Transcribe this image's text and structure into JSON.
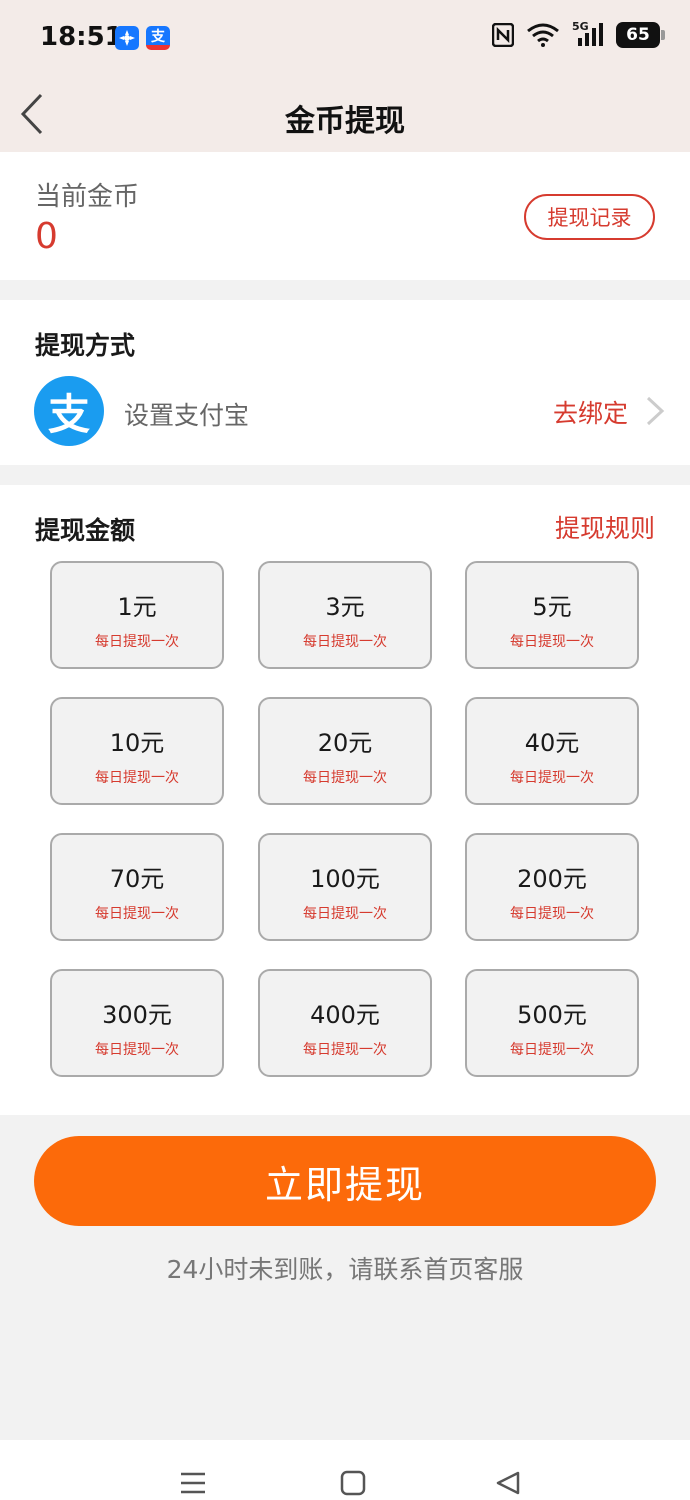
{
  "status_bar": {
    "time": "18:51",
    "app_icon_1": "pinwheel-app-icon",
    "app_icon_2_text": "支",
    "network": "5G",
    "battery": "65"
  },
  "nav": {
    "title": "金币提现",
    "back_icon": "chevron-left-icon"
  },
  "coins": {
    "label": "当前金币",
    "value": "0",
    "record_button": "提现记录"
  },
  "method": {
    "title": "提现方式",
    "icon_text": "支",
    "label": "设置支付宝",
    "bind_link": "去绑定"
  },
  "amount": {
    "title": "提现金额",
    "rules_link": "提现规则",
    "tiles": [
      {
        "value": "1元",
        "note": "每日提现一次"
      },
      {
        "value": "3元",
        "note": "每日提现一次"
      },
      {
        "value": "5元",
        "note": "每日提现一次"
      },
      {
        "value": "10元",
        "note": "每日提现一次"
      },
      {
        "value": "20元",
        "note": "每日提现一次"
      },
      {
        "value": "40元",
        "note": "每日提现一次"
      },
      {
        "value": "70元",
        "note": "每日提现一次"
      },
      {
        "value": "100元",
        "note": "每日提现一次"
      },
      {
        "value": "200元",
        "note": "每日提现一次"
      },
      {
        "value": "300元",
        "note": "每日提现一次"
      },
      {
        "value": "400元",
        "note": "每日提现一次"
      },
      {
        "value": "500元",
        "note": "每日提现一次"
      }
    ]
  },
  "withdraw_button": "立即提现",
  "hint": "24小时未到账，请联系首页客服",
  "colors": {
    "accent_red": "#d63b2f",
    "button_orange": "#fc6a0a",
    "alipay_blue": "#1a9cf0",
    "header_bg": "#f3ebe8"
  }
}
